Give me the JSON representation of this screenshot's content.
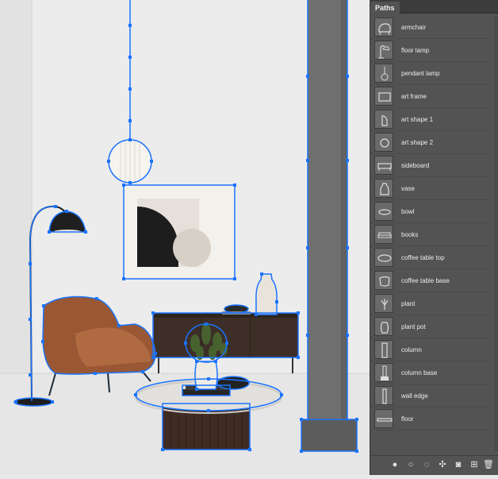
{
  "panel": {
    "tab_label": "Paths",
    "items": [
      {
        "name": "armchair",
        "icon": "armchair-path-thumbnail"
      },
      {
        "name": "floor lamp",
        "icon": "floor-lamp-path-thumbnail"
      },
      {
        "name": "pendant lamp",
        "icon": "pendant-lamp-path-thumbnail"
      },
      {
        "name": "art frame",
        "icon": "art-frame-path-thumbnail"
      },
      {
        "name": "art shape 1",
        "icon": "art-shape-1-path-thumbnail"
      },
      {
        "name": "art shape 2",
        "icon": "art-shape-2-path-thumbnail"
      },
      {
        "name": "sideboard",
        "icon": "sideboard-path-thumbnail"
      },
      {
        "name": "vase",
        "icon": "vase-path-thumbnail"
      },
      {
        "name": "bowl",
        "icon": "bowl-path-thumbnail"
      },
      {
        "name": "books",
        "icon": "books-path-thumbnail"
      },
      {
        "name": "coffee table top",
        "icon": "coffee-table-top-path-thumbnail"
      },
      {
        "name": "coffee table base",
        "icon": "coffee-table-base-path-thumbnail"
      },
      {
        "name": "plant",
        "icon": "plant-path-thumbnail"
      },
      {
        "name": "plant pot",
        "icon": "plant-pot-path-thumbnail"
      },
      {
        "name": "column",
        "icon": "column-path-thumbnail"
      },
      {
        "name": "column base",
        "icon": "column-base-path-thumbnail"
      },
      {
        "name": "wall edge",
        "icon": "wall-edge-path-thumbnail"
      },
      {
        "name": "floor",
        "icon": "floor-path-thumbnail"
      }
    ],
    "footer_icons": [
      "fill-path-icon",
      "stroke-path-icon",
      "load-selection-icon",
      "make-work-path-icon",
      "add-mask-icon",
      "new-path-icon",
      "delete-path-icon"
    ]
  },
  "colors": {
    "path_stroke": "#1a73ff",
    "panel_bg": "#535353",
    "header_bg": "#3c3c3c",
    "wall": "#ececec",
    "column": "#6f6f6f"
  }
}
